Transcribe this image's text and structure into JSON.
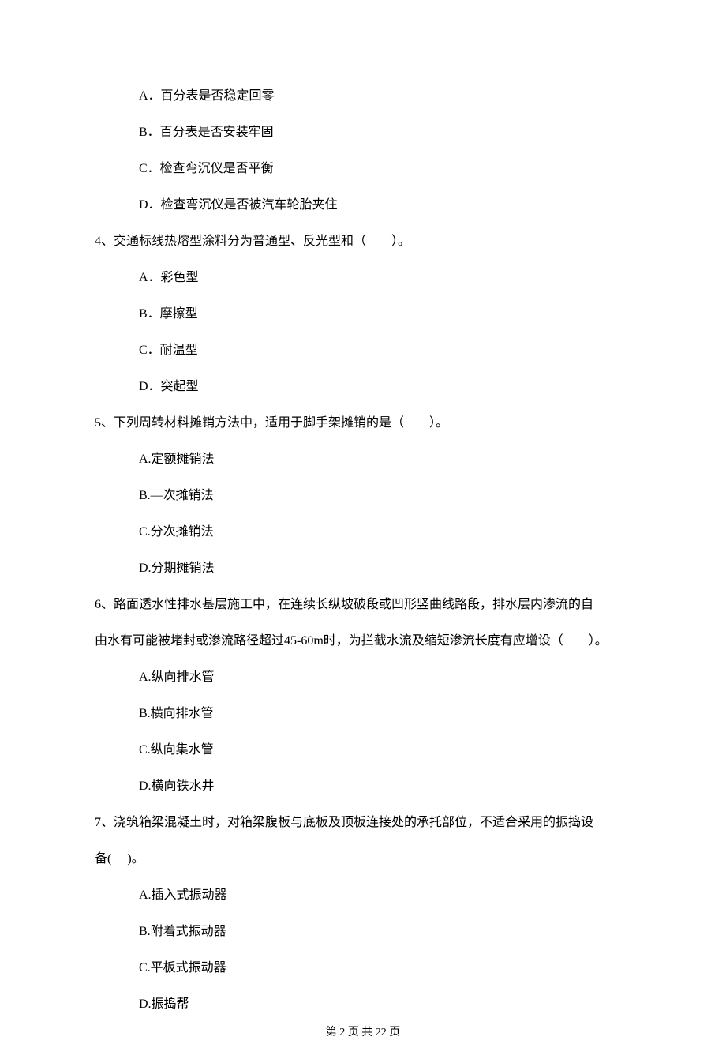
{
  "q3_options": {
    "a": "A．百分表是否稳定回零",
    "b": "B．百分表是否安装牢固",
    "c": "C．检查弯沉仪是否平衡",
    "d": "D．检查弯沉仪是否被汽车轮胎夹住"
  },
  "q4": {
    "stem": "4、交通标线热熔型涂料分为普通型、反光型和（　　）。",
    "a": "A．彩色型",
    "b": "B．摩擦型",
    "c": "C．耐温型",
    "d": "D．突起型"
  },
  "q5": {
    "stem": "5、下列周转材料摊销方法中，适用于脚手架摊销的是（　　）。",
    "a": "A.定额摊销法",
    "b": "B.—次摊销法",
    "c": "C.分次摊销法",
    "d": "D.分期摊销法"
  },
  "q6": {
    "stem_line1": "6、路面透水性排水基层施工中，在连续长纵坡破段或凹形竖曲线路段，排水层内渗流的自",
    "stem_line2": "由水有可能被堵封或渗流路径超过45-60m时，为拦截水流及缩短渗流长度有应增设（　　）。",
    "a": "A.纵向排水管",
    "b": "B.横向排水管",
    "c": "C.纵向集水管",
    "d": "D.横向铁水井"
  },
  "q7": {
    "stem_line1": "7、浇筑箱梁混凝土时，对箱梁腹板与底板及顶板连接处的承托部位，不适合采用的振捣设",
    "stem_line2": "备(　 )。",
    "a": "A.插入式振动器",
    "b": "B.附着式振动器",
    "c": "C.平板式振动器",
    "d": "D.振捣帮"
  },
  "footer": "第 2 页 共 22 页"
}
